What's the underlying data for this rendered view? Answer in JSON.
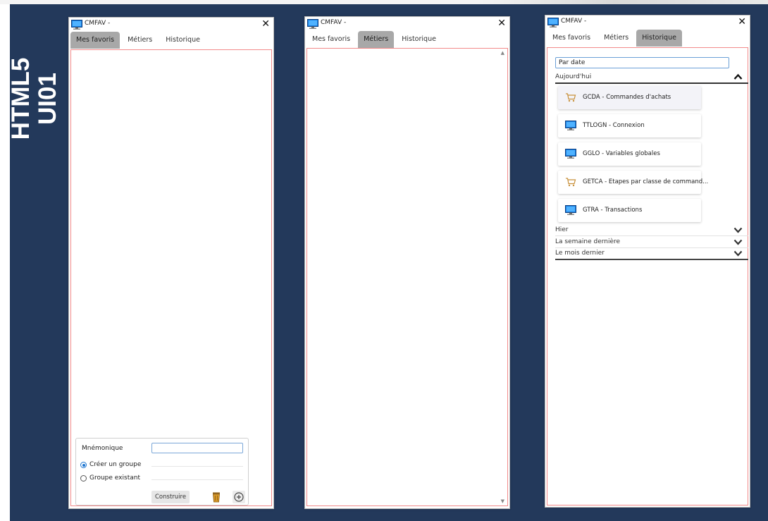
{
  "banner": {
    "line1": "HTML5",
    "line2": "UI01"
  },
  "windows": [
    {
      "title": "CMFAV -",
      "tabs": [
        "Mes favoris",
        "Métiers",
        "Historique"
      ],
      "active_tab": 0,
      "form": {
        "mnemonic_label": "Mnémonique",
        "mnemonic_value": "",
        "radio_create_label": "Créer un groupe",
        "radio_existing_label": "Groupe existant",
        "selected_radio": "create",
        "build_button": "Construire"
      }
    },
    {
      "title": "CMFAV -",
      "tabs": [
        "Mes favoris",
        "Métiers",
        "Historique"
      ],
      "active_tab": 1
    },
    {
      "title": "CMFAV -",
      "tabs": [
        "Mes favoris",
        "Métiers",
        "Historique"
      ],
      "active_tab": 2,
      "search_value": "Par date",
      "sections": [
        {
          "label": "Aujourd'hui",
          "expanded": true
        },
        {
          "label": "Hier",
          "expanded": false
        },
        {
          "label": "La semaine dernière",
          "expanded": false
        },
        {
          "label": "Le mois dernier",
          "expanded": false
        }
      ],
      "items": [
        {
          "label": "GCDA - Commandes d'achats",
          "icon": "cart-icon"
        },
        {
          "label": "TTLOGN - Connexion",
          "icon": "monitor-icon"
        },
        {
          "label": "GGLO - Variables globales",
          "icon": "monitor-icon"
        },
        {
          "label": "GETCA - Etapes par classe de command...",
          "icon": "cart-icon"
        },
        {
          "label": "GTRA - Transactions",
          "icon": "monitor-icon"
        }
      ]
    }
  ],
  "colors": {
    "backdrop": "#23395b",
    "panel_border": "#f28a8a",
    "active_tab": "#a8a8a8",
    "accent": "#1b74d0"
  }
}
